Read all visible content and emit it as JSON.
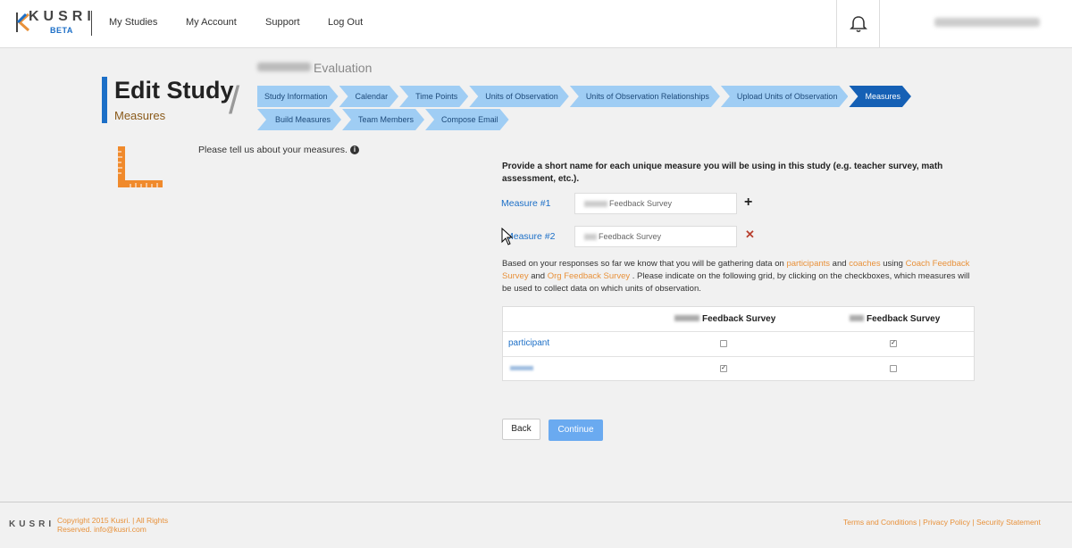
{
  "header": {
    "logo_text": "KUSRI",
    "logo_badge": "BETA",
    "nav": [
      "My Studies",
      "My Account",
      "Support",
      "Log Out"
    ]
  },
  "page": {
    "title": "Edit Study",
    "subtitle": "Measures",
    "study_name_suffix": "Evaluation"
  },
  "steps": {
    "row1": [
      "Study Information",
      "Calendar",
      "Time Points",
      "Units of Observation",
      "Units of Observation Relationships",
      "Upload Units of Observation",
      "Measures"
    ],
    "row2": [
      "Build Measures",
      "Team Members",
      "Compose Email"
    ],
    "active": "Measures"
  },
  "intro": "Please tell us about your measures.",
  "prompt": "Provide a short name for each unique measure you will be using in this study (e.g. teacher survey, math assessment, etc.).",
  "measures": [
    {
      "label": "Measure #1",
      "value": "Feedback Survey"
    },
    {
      "label": "Measure #2",
      "value": "Feedback Survey"
    }
  ],
  "info": {
    "part1": "Based on your responses so far we know that you will be gathering data on ",
    "unit1": "participants",
    "and1": " and ",
    "unit2": "coaches",
    "using": " using ",
    "measure1": "Coach Feedback Survey",
    "and2": " and ",
    "measure2": "Org Feedback Survey",
    "rest": " . Please indicate on the following grid, by clicking on the checkboxes, which measures will be used to collect data on which units of observation."
  },
  "grid": {
    "col1": "Feedback Survey",
    "col2": "Feedback Survey",
    "rows": [
      {
        "label": "participant",
        "c1": false,
        "c2": true
      },
      {
        "label": "",
        "c1": true,
        "c2": false
      }
    ]
  },
  "buttons": {
    "back": "Back",
    "continue": "Continue"
  },
  "footer": {
    "logo": "KUSRI",
    "copy1": "Copyright 2015 Kusri. | All Rights",
    "copy2": "Reserved.",
    "email": "info@kusri.com",
    "terms": "Terms and Conditions",
    "privacy": "Privacy Policy",
    "security": "Security Statement"
  },
  "colors": {
    "primary": "#1c6fc7",
    "accent": "#e8913a",
    "step": "#9fcdf4",
    "step_active": "#1560b5"
  }
}
